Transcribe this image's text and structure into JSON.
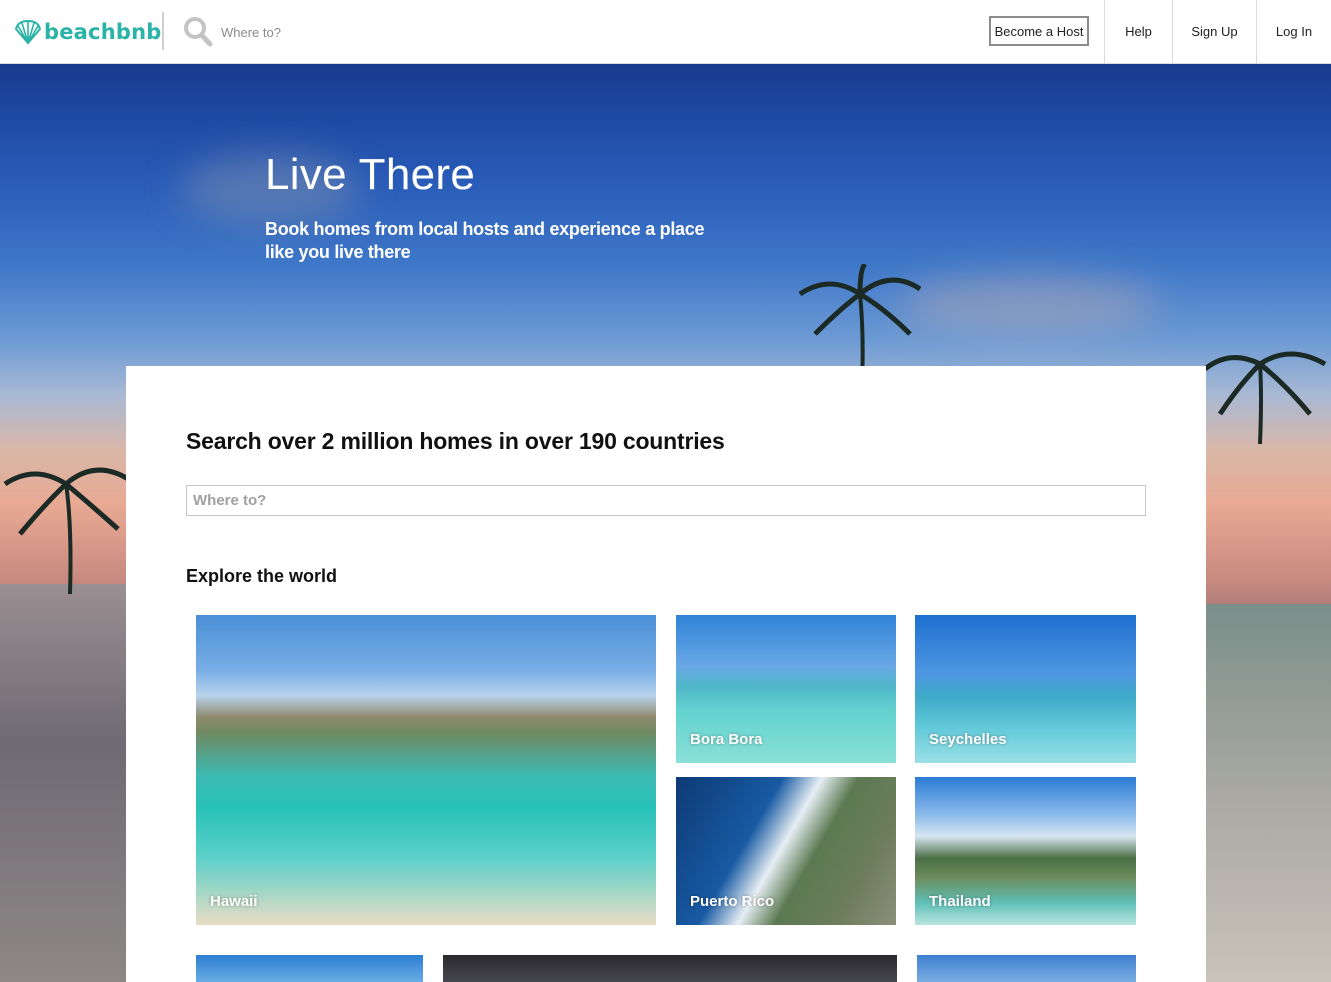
{
  "navbar": {
    "logo_text": "beachbnb",
    "search_placeholder": "Where to?",
    "become_host_label": "Become a Host",
    "help_label": "Help",
    "signup_label": "Sign Up",
    "login_label": "Log In"
  },
  "hero": {
    "title": "Live There",
    "subtitle": "Book homes from local hosts and experience a place like you live there"
  },
  "search_card": {
    "title": "Search over 2 million homes in over 190 countries",
    "search_placeholder": "Where to?",
    "explore_title": "Explore the world"
  },
  "destinations": [
    {
      "label": "Hawaii"
    },
    {
      "label": "Bora Bora"
    },
    {
      "label": "Seychelles"
    },
    {
      "label": "Puerto Rico"
    },
    {
      "label": "Thailand"
    }
  ],
  "colors": {
    "brand": "#2ab3a7",
    "nav_border": "#dcdcdc",
    "host_button_border": "#8c8c8c"
  },
  "icons": {
    "logo": "shell-logo-icon",
    "search": "search-icon"
  }
}
